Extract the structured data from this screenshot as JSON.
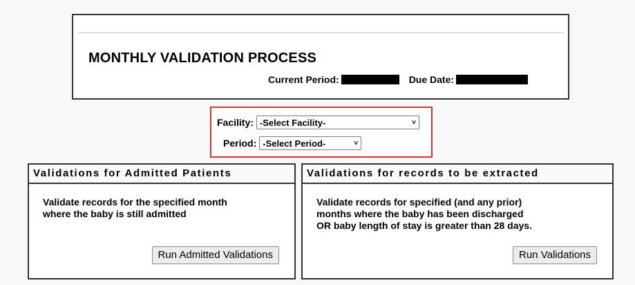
{
  "header": {
    "title": "MONTHLY VALIDATION PROCESS",
    "current_period_label": "Current Period:",
    "due_date_label": "Due Date:"
  },
  "selectors": {
    "facility_label": "Facility:",
    "facility_value": "-Select Facility-",
    "period_label": "Period:",
    "period_value": "-Select Period-"
  },
  "panels": {
    "admitted": {
      "title": "Validations for Admitted Patients",
      "description": [
        "Validate records for the specified month",
        "where the baby is still admitted"
      ],
      "button_label": "Run Admitted Validations"
    },
    "extracted": {
      "title": "Validations for records to be extracted",
      "description": [
        "Validate records for specified (and any prior)",
        "months where the baby has been discharged",
        "OR baby length of stay is greater than 28 days."
      ],
      "button_label": "Run Validations"
    }
  },
  "colors": {
    "highlight_border": "#d9342b",
    "redaction": "#000000"
  }
}
